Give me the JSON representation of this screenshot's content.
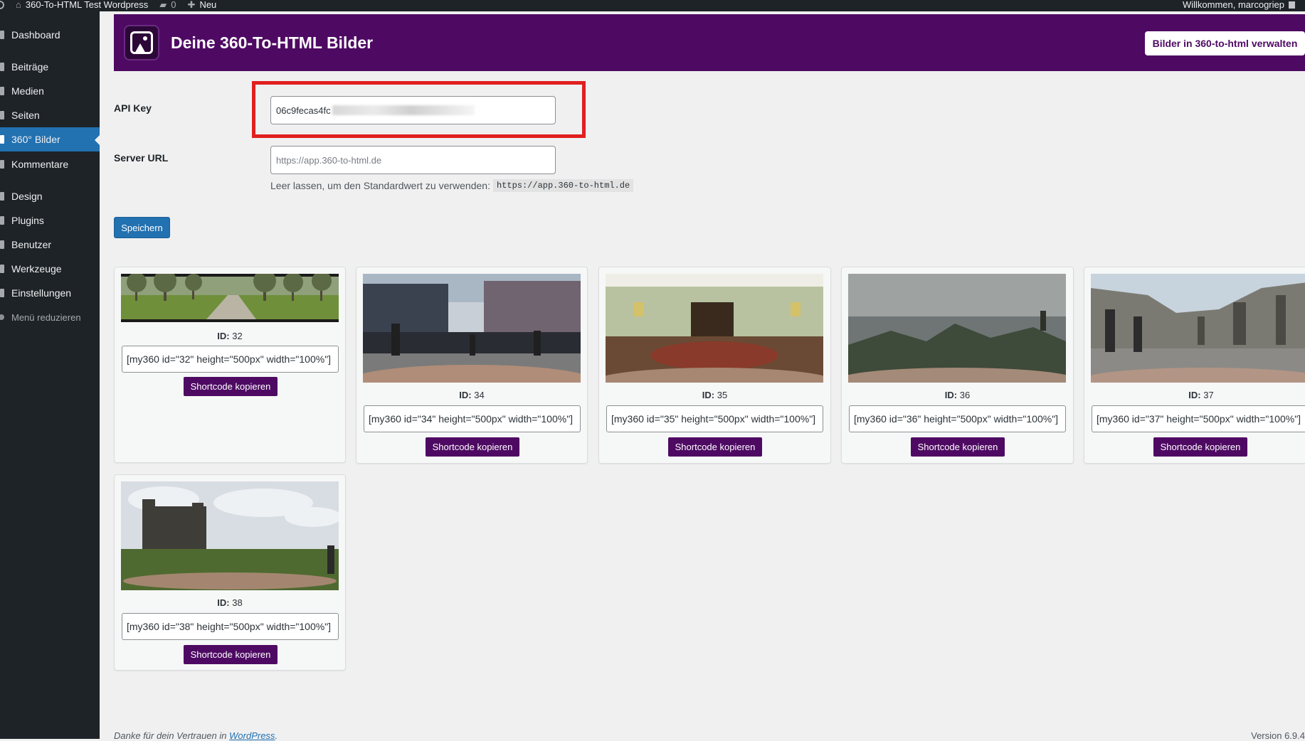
{
  "adminbar": {
    "site_name": "360-To-HTML Test Wordpress",
    "comments_count": "0",
    "new_label": "Neu",
    "greeting": "Willkommen, marcogriep"
  },
  "sidebar": {
    "items": [
      {
        "label": "Dashboard",
        "icon": "dashboard-icon"
      },
      {
        "label": "Beiträge",
        "icon": "pin-icon"
      },
      {
        "label": "Medien",
        "icon": "media-icon"
      },
      {
        "label": "Seiten",
        "icon": "page-icon"
      },
      {
        "label": "360° Bilder",
        "icon": "image-icon",
        "active": true
      },
      {
        "label": "Kommentare",
        "icon": "comment-icon"
      },
      {
        "label": "Design",
        "icon": "brush-icon"
      },
      {
        "label": "Plugins",
        "icon": "plugin-icon"
      },
      {
        "label": "Benutzer",
        "icon": "users-icon"
      },
      {
        "label": "Werkzeuge",
        "icon": "wrench-icon"
      },
      {
        "label": "Einstellungen",
        "icon": "settings-icon"
      },
      {
        "label": "Menü reduzieren",
        "icon": "collapse-icon"
      }
    ]
  },
  "header": {
    "title": "Deine 360-To-HTML Bilder",
    "manage_button": "Bilder in 360-to-html verwalten"
  },
  "form": {
    "api_key_label": "API Key",
    "api_key_value": "06c9fecas4fc",
    "server_url_label": "Server URL",
    "server_url_placeholder": "https://app.360-to-html.de",
    "hint_text": "Leer lassen, um den Standardwert zu verwenden:",
    "hint_code": "https://app.360-to-html.de",
    "save_button": "Speichern"
  },
  "images": [
    {
      "id_label": "ID:",
      "id": "32",
      "shortcode": "[my360 id=\"32\" height=\"500px\" width=\"100%\"]",
      "button": "Shortcode kopieren"
    },
    {
      "id_label": "ID:",
      "id": "34",
      "shortcode": "[my360 id=\"34\" height=\"500px\" width=\"100%\"]",
      "button": "Shortcode kopieren"
    },
    {
      "id_label": "ID:",
      "id": "35",
      "shortcode": "[my360 id=\"35\" height=\"500px\" width=\"100%\"]",
      "button": "Shortcode kopieren"
    },
    {
      "id_label": "ID:",
      "id": "36",
      "shortcode": "[my360 id=\"36\" height=\"500px\" width=\"100%\"]",
      "button": "Shortcode kopieren"
    },
    {
      "id_label": "ID:",
      "id": "37",
      "shortcode": "[my360 id=\"37\" height=\"500px\" width=\"100%\"]",
      "button": "Shortcode kopieren"
    },
    {
      "id_label": "ID:",
      "id": "38",
      "shortcode": "[my360 id=\"38\" height=\"500px\" width=\"100%\"]",
      "button": "Shortcode kopieren"
    }
  ],
  "footer": {
    "thanks_text": "Danke für dein Vertrauen in",
    "wordpress_link": "WordPress",
    "version": "Version 6.9.4"
  },
  "colors": {
    "brand_purple": "#4e0a63",
    "wp_blue": "#2271b1",
    "highlight_red": "#e0201f"
  }
}
